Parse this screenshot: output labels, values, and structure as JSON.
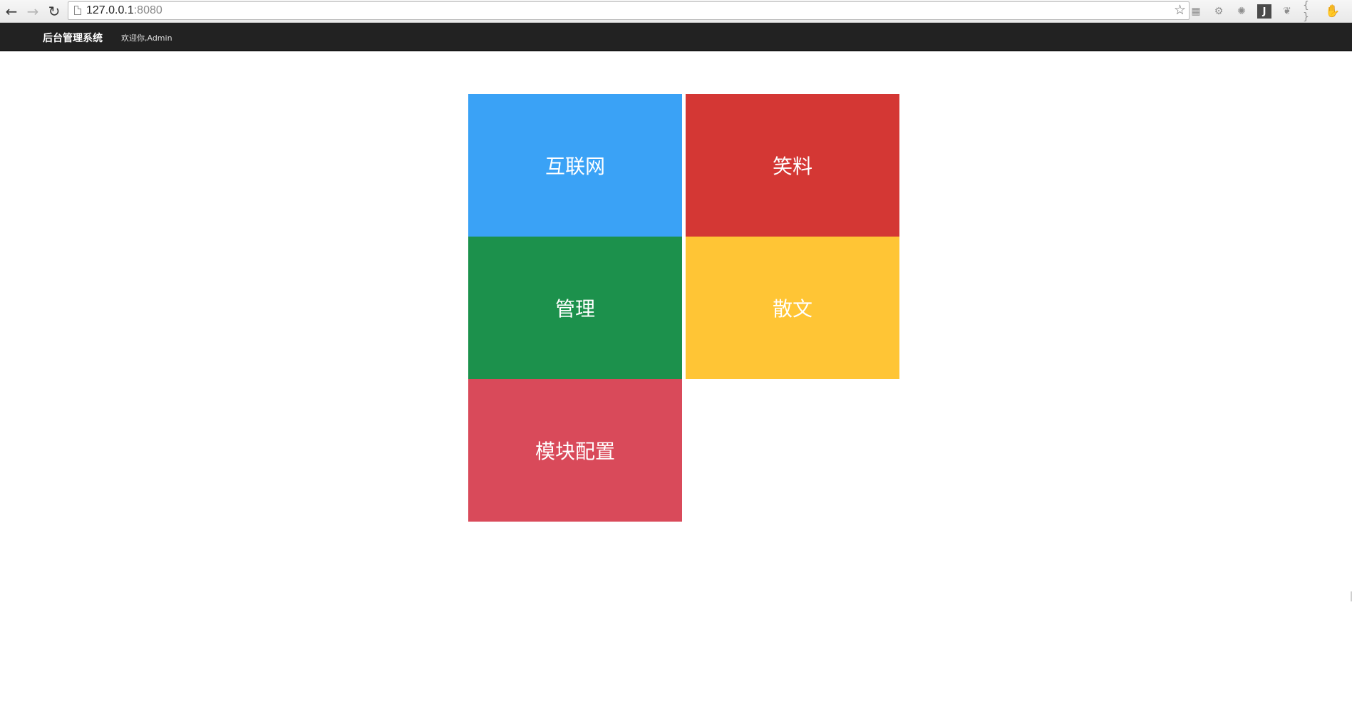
{
  "browser": {
    "url_host": "127.0.0.1",
    "url_port": ":8080",
    "back_icon": "arrow-left-icon",
    "forward_icon": "arrow-right-icon",
    "reload_icon": "reload-icon",
    "bookmark_icon": "star-icon",
    "extensions": [
      {
        "name": "grid-extension-icon",
        "glyph": "▦"
      },
      {
        "name": "gear-extension-icon",
        "glyph": "⚙"
      },
      {
        "name": "atom-extension-icon",
        "glyph": "✺"
      },
      {
        "name": "j-extension-icon",
        "glyph": "J"
      },
      {
        "name": "leaf-extension-icon",
        "glyph": "❦"
      },
      {
        "name": "braces-extension-icon",
        "glyph": "{ }"
      },
      {
        "name": "fire-extension-icon",
        "glyph": "✋"
      }
    ]
  },
  "navbar": {
    "brand": "后台管理系统",
    "welcome": "欢迎你,Admin",
    "background": "#222222"
  },
  "tiles": [
    {
      "label": "互联网",
      "color": "#3aa2f6"
    },
    {
      "label": "笑料",
      "color": "#d43734"
    },
    {
      "label": "管理",
      "color": "#1c914c"
    },
    {
      "label": "散文",
      "color": "#ffc535"
    },
    {
      "label": "模块配置",
      "color": "#d94a5a"
    }
  ]
}
